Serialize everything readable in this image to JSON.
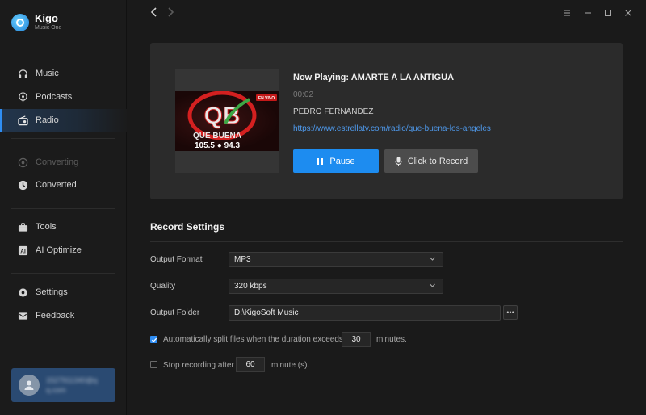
{
  "app": {
    "name": "Kigo",
    "subtitle": "Music One"
  },
  "sidebar": {
    "items": [
      {
        "label": "Music",
        "icon": "headphones-icon"
      },
      {
        "label": "Podcasts",
        "icon": "podcast-icon"
      },
      {
        "label": "Radio",
        "icon": "radio-icon",
        "active": true
      },
      {
        "label": "Converting",
        "icon": "converting-icon",
        "disabled": true
      },
      {
        "label": "Converted",
        "icon": "clock-icon"
      },
      {
        "label": "Tools",
        "icon": "toolbox-icon"
      },
      {
        "label": "AI Optimize",
        "icon": "ai-icon"
      },
      {
        "label": "Settings",
        "icon": "gear-icon"
      },
      {
        "label": "Feedback",
        "icon": "mail-icon"
      }
    ],
    "user": {
      "name": "1527911340@q q.com"
    }
  },
  "player": {
    "now_playing": "Now Playing: AMARTE A LA ANTIGUA",
    "time": "00:02",
    "artist": "PEDRO FERNANDEZ",
    "url": "https://www.estrellatv.com/radio/que-buena-los-angeles",
    "pause_label": "Pause",
    "record_label": "Click to Record",
    "cover": {
      "logo": "QB",
      "name": "QUE BUENA",
      "freq": "105.5 ● 94.3",
      "badge": "EN VIVO"
    }
  },
  "record_settings": {
    "title": "Record Settings",
    "output_format_label": "Output Format",
    "output_format_value": "MP3",
    "quality_label": "Quality",
    "quality_value": "320 kbps",
    "output_folder_label": "Output Folder",
    "output_folder_value": "D:\\KigoSoft Music",
    "more_label": "•••",
    "split_label": "Automatically split files when the duration exceeds",
    "split_value": "30",
    "split_unit": "minutes.",
    "split_checked": true,
    "stop_label": "Stop recording after",
    "stop_value": "60",
    "stop_unit": "minute (s).",
    "stop_checked": false
  },
  "colors": {
    "accent": "#1d8cf0",
    "panel": "#2b2b2b",
    "background": "#1a1a1a"
  }
}
